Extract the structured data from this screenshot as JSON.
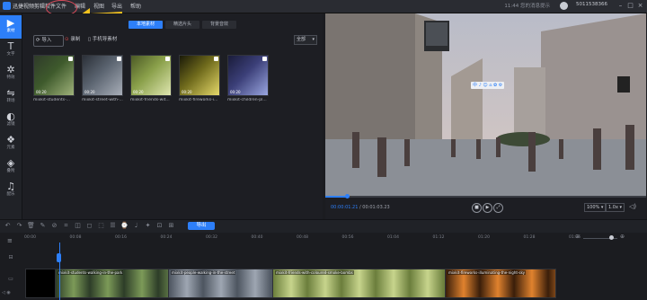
{
  "app": {
    "title": "迅捷视频剪辑软件",
    "menu": [
      "文件",
      "编辑",
      "视图",
      "导出",
      "帮助"
    ],
    "notice": "11:44 您的消息提示",
    "user_id": "5011538366",
    "window_controls": [
      "minimize-icon",
      "maximize-icon",
      "close-icon"
    ]
  },
  "sidebar": {
    "items": [
      {
        "label": "素材",
        "icon": "media-icon",
        "glyph": "▶"
      },
      {
        "label": "文字",
        "icon": "text-icon",
        "glyph": "T"
      },
      {
        "label": "特效",
        "icon": "effects-icon",
        "glyph": "✲"
      },
      {
        "label": "转场",
        "icon": "transition-icon",
        "glyph": "⇋"
      },
      {
        "label": "滤镜",
        "icon": "filter-icon",
        "glyph": "◐"
      },
      {
        "label": "元素",
        "icon": "element-icon",
        "glyph": "❖"
      },
      {
        "label": "叠附",
        "icon": "layer-icon",
        "glyph": "◈"
      },
      {
        "label": "配乐",
        "icon": "music-icon",
        "glyph": "♫"
      }
    ]
  },
  "media": {
    "tabs": [
      "本地素材",
      "精选片头",
      "背景音效"
    ],
    "import_label": "导入",
    "record_label": "录制",
    "mobile_label": "手机导素材",
    "filter_value": "全部",
    "clips": [
      {
        "name": "mixkit-students-...",
        "duration": "00:20",
        "colors": [
          "#3e5a2c",
          "#9fb27a",
          "#2f3a2a"
        ]
      },
      {
        "name": "mixkit-street-with-...",
        "duration": "00:20",
        "colors": [
          "#5b6470",
          "#a8aeb8",
          "#2b3038"
        ]
      },
      {
        "name": "mixkit-friends-wit...",
        "duration": "00:20",
        "colors": [
          "#8aa04a",
          "#dfe6b0",
          "#4c5a26"
        ]
      },
      {
        "name": "mixkit-fireworks-i...",
        "duration": "00:20",
        "colors": [
          "#6f6a1c",
          "#e4d86a",
          "#1a1a08"
        ]
      },
      {
        "name": "mixkit-children-pl...",
        "duration": "00:20",
        "colors": [
          "#3b3f78",
          "#9aa6e0",
          "#1a1c3a"
        ]
      }
    ]
  },
  "preview": {
    "current_time": "00:00:01.21",
    "total_time": "00:01:03.23",
    "progress": 0.067,
    "quality_value": "100%",
    "speed_value": "1.0x",
    "overlay_icons": [
      "中",
      "♪",
      "☺",
      "⌂",
      "✿",
      "⚙"
    ]
  },
  "toolbar": {
    "export_label": "导出",
    "tools": [
      "↶",
      "↷",
      "🗑",
      "✎",
      "⊘",
      "⌗",
      "◫",
      "◻",
      "⬚",
      "☰",
      "⌚",
      "♩",
      "✦",
      "⊡",
      "⊞"
    ]
  },
  "timeline": {
    "ticks": [
      "00:00",
      "00:08",
      "00:16",
      "00:24",
      "00:32",
      "00:40",
      "00:48",
      "00:56",
      "01:04",
      "01:12",
      "01:20",
      "01:28",
      "01:36"
    ],
    "clips": [
      {
        "label": "mixkit-students-walking-in-the-park",
        "colors": [
          "#2d3d28",
          "#7c9a58"
        ]
      },
      {
        "label": "mixkit-people-walking-in-the-street",
        "colors": [
          "#4d5560",
          "#9ea6b2"
        ]
      },
      {
        "label": "mixkit-friends-with-coloured-smoke-bombs",
        "colors": [
          "#6b7e3c",
          "#c7d48c"
        ]
      },
      {
        "label": "mixkit-fireworks-illuminating-the-night-sky",
        "colors": [
          "#3a1e0a",
          "#e0822e"
        ]
      }
    ]
  }
}
